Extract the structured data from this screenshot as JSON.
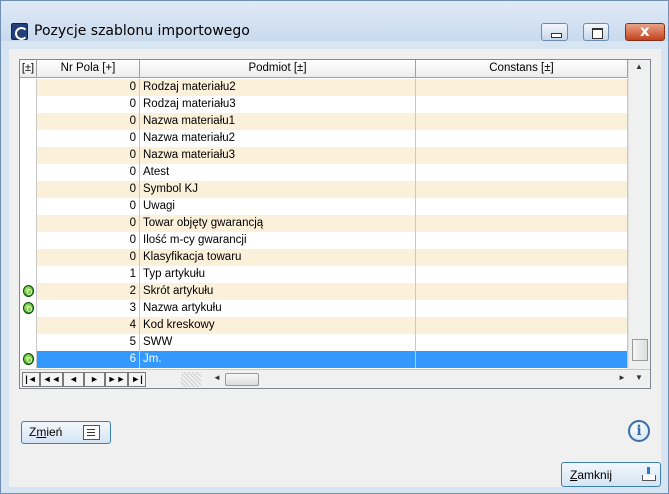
{
  "window": {
    "title": "Pozycje szablonu importowego"
  },
  "grid": {
    "columns": {
      "indicator": "[±]",
      "nr": "Nr Pola [+]",
      "podmiot": "Podmiot [±]",
      "constans": "Constans [±]"
    },
    "rows": [
      {
        "nr": "0",
        "podmiot": "Rodzaj materiału2",
        "constans": "",
        "icon": false
      },
      {
        "nr": "0",
        "podmiot": "Rodzaj materiału3",
        "constans": "",
        "icon": false
      },
      {
        "nr": "0",
        "podmiot": "Nazwa materiału1",
        "constans": "",
        "icon": false
      },
      {
        "nr": "0",
        "podmiot": "Nazwa materiału2",
        "constans": "",
        "icon": false
      },
      {
        "nr": "0",
        "podmiot": "Nazwa materiału3",
        "constans": "",
        "icon": false
      },
      {
        "nr": "0",
        "podmiot": "Atest",
        "constans": "",
        "icon": false
      },
      {
        "nr": "0",
        "podmiot": "Symbol KJ",
        "constans": "",
        "icon": false
      },
      {
        "nr": "0",
        "podmiot": "Uwagi",
        "constans": "",
        "icon": false
      },
      {
        "nr": "0",
        "podmiot": "Towar objęty gwarancją",
        "constans": "",
        "icon": false
      },
      {
        "nr": "0",
        "podmiot": "Ilość m-cy gwarancji",
        "constans": "",
        "icon": false
      },
      {
        "nr": "0",
        "podmiot": "Klasyfikacja towaru",
        "constans": "",
        "icon": false
      },
      {
        "nr": "1",
        "podmiot": "Typ artykułu",
        "constans": "",
        "icon": false
      },
      {
        "nr": "2",
        "podmiot": "Skrót artykułu",
        "constans": "",
        "icon": true
      },
      {
        "nr": "3",
        "podmiot": "Nazwa artykułu",
        "constans": "",
        "icon": true
      },
      {
        "nr": "4",
        "podmiot": "Kod kreskowy",
        "constans": "",
        "icon": false
      },
      {
        "nr": "5",
        "podmiot": "SWW",
        "constans": "",
        "icon": false
      },
      {
        "nr": "6",
        "podmiot": "Jm.",
        "constans": "",
        "icon": true,
        "selected": true
      }
    ],
    "nav_buttons": [
      "|◄",
      "◄◄",
      "◄",
      "►",
      "►►",
      "►|"
    ]
  },
  "buttons": {
    "zmien_accel": "m",
    "zmien_pre": "Z",
    "zmien_post": "ień",
    "zamknij_accel": "Z",
    "zamknij_post": "amknij"
  },
  "icons": {
    "info": "info-icon",
    "key": "green-key-icon"
  }
}
